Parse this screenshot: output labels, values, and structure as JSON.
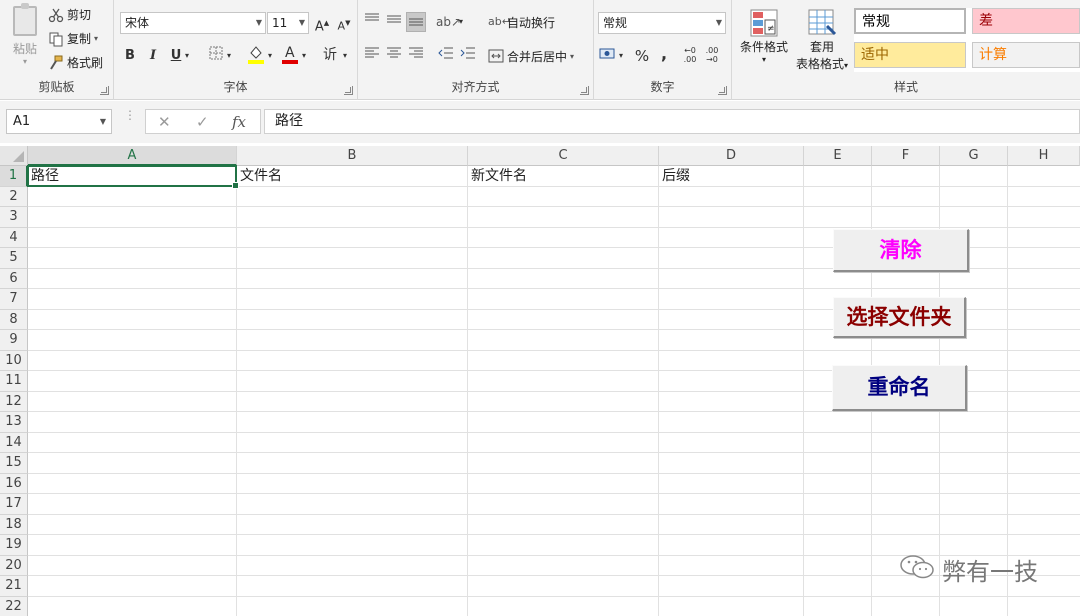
{
  "ribbon": {
    "clipboard": {
      "paste_label": "粘贴",
      "cut_label": "剪切",
      "copy_label": "复制",
      "format_painter_label": "格式刷",
      "group_label": "剪贴板"
    },
    "font": {
      "font_name": "宋体",
      "font_size": "11",
      "bold": "B",
      "italic": "I",
      "underline": "U",
      "group_label": "字体"
    },
    "alignment": {
      "wrap_text_label": "自动换行",
      "merge_center_label": "合并后居中",
      "group_label": "对齐方式"
    },
    "number": {
      "format_value": "常规",
      "percent": "%",
      "comma": ",",
      "group_label": "数字"
    },
    "styles": {
      "conditional_format_label": "条件格式",
      "table_format_label_line1": "套用",
      "table_format_label_line2": "表格格式",
      "gallery": [
        {
          "label": "常规",
          "color": "#000000",
          "bg": "#ffffff"
        },
        {
          "label": "差",
          "color": "#9c0006",
          "bg": "#ffc7ce"
        },
        {
          "label": "适中",
          "color": "#9c6500",
          "bg": "#ffeb9c"
        },
        {
          "label": "计算",
          "color": "#fa7d00",
          "bg": "#f2f2f2"
        }
      ],
      "group_label": "样式"
    }
  },
  "formula_bar": {
    "name_box": "A1",
    "fx": "fx",
    "content": "路径"
  },
  "columns": [
    "A",
    "B",
    "C",
    "D",
    "E",
    "F",
    "G",
    "H"
  ],
  "rows": [
    "1",
    "2",
    "3",
    "4",
    "5",
    "6",
    "7",
    "8",
    "9",
    "10",
    "11",
    "12",
    "13",
    "14",
    "15",
    "16",
    "17",
    "18",
    "19",
    "20",
    "21",
    "22"
  ],
  "cells": {
    "A1": "路径",
    "B1": "文件名",
    "C1": "新文件名",
    "D1": "后缀"
  },
  "buttons": {
    "clear": {
      "label": "清除",
      "color": "#ff00ff"
    },
    "select_folder": {
      "label": "选择文件夹",
      "color": "#8b0000"
    },
    "rename": {
      "label": "重命名",
      "color": "#000080"
    }
  },
  "watermark": {
    "text": "弊有一技"
  }
}
